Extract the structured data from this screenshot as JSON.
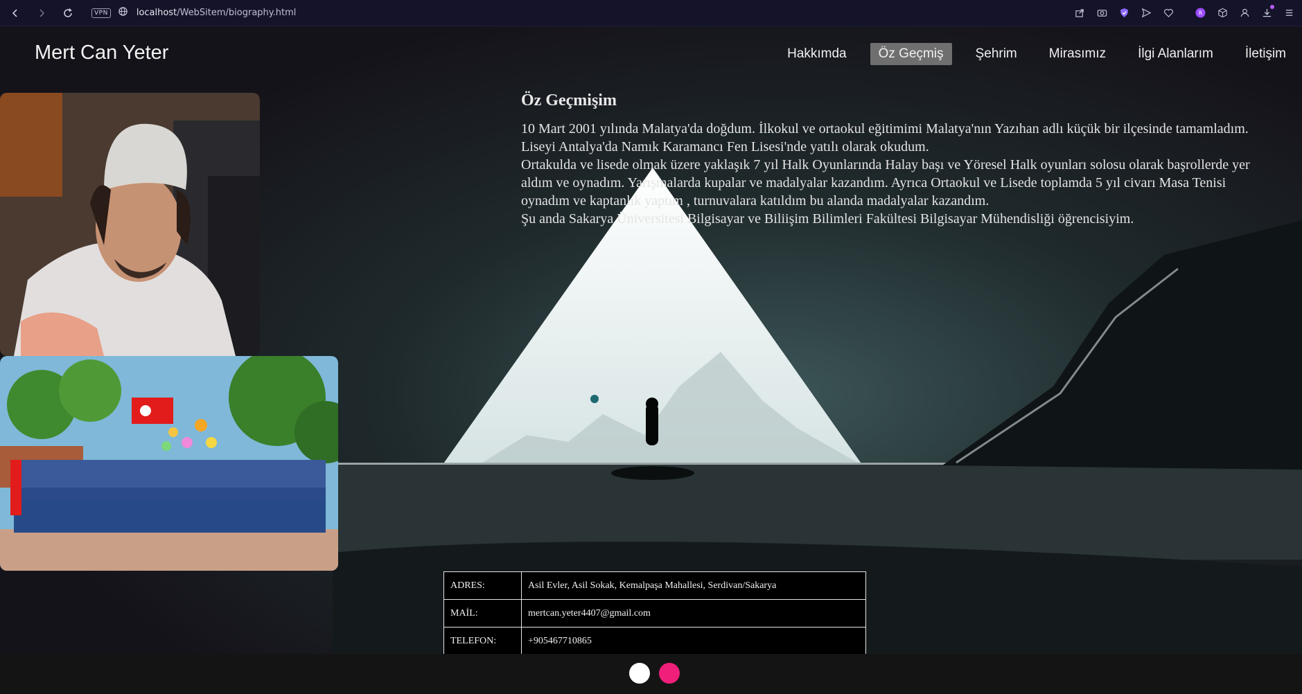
{
  "browser": {
    "url_host": "localhost",
    "url_path": "/WebSitem/biography.html",
    "vpn_label": "VPN",
    "icons": [
      "back-icon",
      "forward-icon",
      "reload-icon",
      "vpn-badge",
      "globe-icon",
      "share-icon",
      "camera-icon",
      "shield-icon",
      "send-icon",
      "heart-icon",
      "profile-avatar-icon",
      "cube-icon",
      "user-icon",
      "download-icon",
      "menu-icon"
    ]
  },
  "site": {
    "title": "Mert Can Yeter",
    "nav": [
      {
        "label": "Hakkımda"
      },
      {
        "label": "Öz Geçmiş",
        "active": true
      },
      {
        "label": "Şehrim"
      },
      {
        "label": "Mirasımız"
      },
      {
        "label": "İlgi Alanlarım"
      },
      {
        "label": "İletişim"
      }
    ]
  },
  "biography": {
    "heading": "Öz Geçmişim",
    "paragraph1": "10 Mart 2001 yılında Malatya'da doğdum. İlkokul ve ortaokul eğitimimi Malatya'nın Yazıhan adlı küçük bir ilçesinde tamamladım. Liseyi Antalya'da Namık Karamancı Fen Lisesi'nde yatılı olarak okudum.",
    "paragraph2": "Ortakulda ve lisede olmak üzere yaklaşık 7 yıl Halk Oyunlarında Halay başı ve Yöresel Halk oyunları solosu olarak başrollerde yer aldım ve oynadım. Yarışmalarda kupalar ve madalyalar kazandım. Ayrıca Ortaokul ve Lisede toplamda 5 yıl civarı Masa Tenisi oynadım ve kaptanlık yaptım , turnuvalara katıldım bu alanda madalyalar kazandım.",
    "paragraph3": "Şu anda Sakarya Üniversitesi Bilgisayar ve Biliişim Bilimleri Fakültesi Bilgisayar Mühendisliği öğrencisiyim."
  },
  "contact": {
    "rows": [
      {
        "key": "ADRES:",
        "value": "Asil Evler, Asil Sokak, Kemalpaşa Mahallesi, Serdivan/Sakarya"
      },
      {
        "key": "MAİL:",
        "value": "mertcan.yeter4407@gmail.com"
      },
      {
        "key": "TELEFON:",
        "value": "+905467710865"
      }
    ]
  },
  "colors": {
    "accent_pink": "#f0207a",
    "active_nav_bg": "#6f6f6f",
    "browser_bar": "#14132a"
  }
}
